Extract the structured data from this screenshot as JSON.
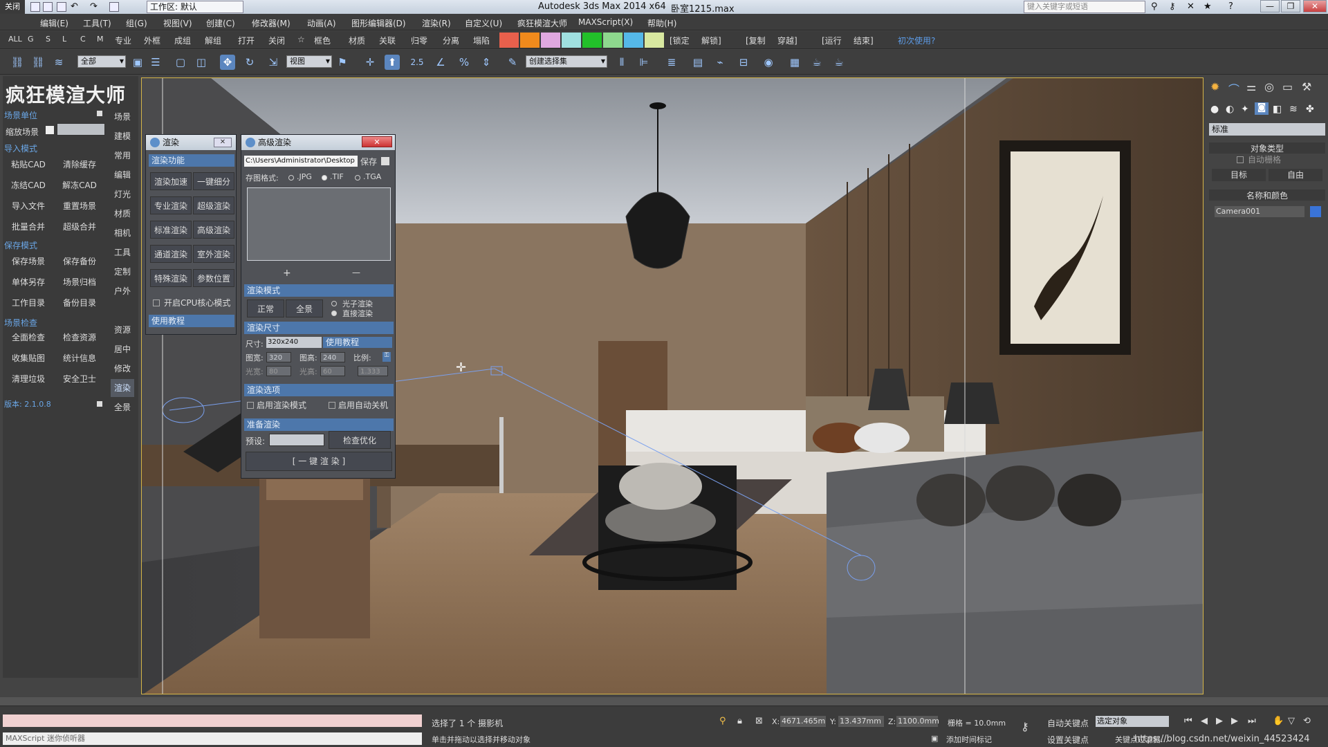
{
  "titlebar": {
    "close_label": "关闭",
    "workspace": "工作区: 默认",
    "app_title": "Autodesk 3ds Max  2014 x64",
    "file_name": "卧室1215.max",
    "search_placeholder": "键入关键字或短语"
  },
  "menu": [
    "编辑(E)",
    "工具(T)",
    "组(G)",
    "视图(V)",
    "创建(C)",
    "修改器(M)",
    "动画(A)",
    "图形编辑器(D)",
    "渲染(R)",
    "自定义(U)",
    "疯狂模渲大师",
    "MAXScript(X)",
    "帮助(H)"
  ],
  "quickrow": {
    "filters": [
      "ALL",
      "G",
      "S",
      "L",
      "C",
      "M"
    ],
    "items": [
      "专业",
      "外框",
      "成组",
      "解组",
      "打开",
      "关闭",
      "☆",
      "框色",
      "材质",
      "关联",
      "归零",
      "分离",
      "塌陷"
    ],
    "swatch_colors": [
      "#e8604c",
      "#f08a1c",
      "#e0a8e0",
      "#9fe0e0",
      "#22c02a",
      "#8ed88e",
      "#55b8e8",
      "#d8e8a0"
    ],
    "right_items": [
      "[锁定",
      "解锁]",
      "[复制",
      "穿越]",
      "[运行",
      "结束]",
      "初次使用?"
    ]
  },
  "toolbar": {
    "filter_select": "全部",
    "view_select": "视图",
    "selection_set": "创建选择集",
    "snap_label": "2.5"
  },
  "plugin": {
    "title": "疯狂模渲大师",
    "scene_unit": "场景单位",
    "scale_scene": "缩放场景",
    "import_mode": "导入模式",
    "import_buttons": [
      "粘贴CAD",
      "清除缓存",
      "冻结CAD",
      "解冻CAD",
      "导入文件",
      "重置场景",
      "批量合并",
      "超级合并"
    ],
    "save_mode": "保存模式",
    "save_buttons": [
      "保存场景",
      "保存备份",
      "单体另存",
      "场景归档",
      "工作目录",
      "备份目录"
    ],
    "check_mode": "场景检查",
    "check_buttons": [
      "全面检查",
      "检查资源",
      "收集贴图",
      "统计信息",
      "清理垃圾",
      "安全卫士"
    ],
    "version": "版本: 2.1.0.8",
    "tabs": [
      "场景",
      "建模",
      "常用",
      "编辑",
      "灯光",
      "材质",
      "相机",
      "工具",
      "定制",
      "户外",
      "资源",
      "居中",
      "修改",
      "渲染",
      "全景"
    ],
    "active_tab": "渲染"
  },
  "render_dialog": {
    "title": "渲染",
    "section": "渲染功能",
    "buttons": [
      "渲染加速",
      "一键细分",
      "专业渲染",
      "超级渲染",
      "标准渲染",
      "高级渲染",
      "通道渲染",
      "室外渲染",
      "特殊渲染",
      "参数位置"
    ],
    "cpu_checkbox": "开启CPU核心模式",
    "tutorial": "使用教程"
  },
  "adv_dialog": {
    "title": "高级渲染",
    "path": "C:\\Users\\Administrator\\Desktop",
    "save_label": "保存",
    "format_label": "存图格式:",
    "formats": [
      ".JPG",
      ".TIF",
      ".TGA"
    ],
    "selected_format": ".TIF",
    "plus": "+",
    "minus": "—",
    "mode_header": "渲染模式",
    "mode_normal": "正常",
    "mode_pano": "全景",
    "radio_photon": "光子渲染",
    "radio_direct": "直接渲染",
    "size_header": "渲染尺寸",
    "size_label": "尺寸:",
    "size_value": "320x240",
    "size_tutorial": "使用教程",
    "img_w_label": "图宽:",
    "img_w": "320",
    "img_h_label": "图高:",
    "img_h": "240",
    "ratio_label": "比例:",
    "light_w_label": "光宽:",
    "light_w": "80",
    "light_h_label": "光高:",
    "light_h": "60",
    "ratio_value": "1.333",
    "options_header": "渲染选项",
    "opt_render_mode": "启用渲染模式",
    "opt_auto_shutdown": "启用自动关机",
    "prep_header": "准备渲染",
    "preset_label": "预设:",
    "check_opt": "检查优化",
    "one_click": "[ 一 键 渲 染 ]"
  },
  "rpanel": {
    "dropdown": "标准",
    "object_type": "对象类型",
    "auto_grid": "自动栅格",
    "target": "目标",
    "free": "自由",
    "name_color": "名称和颜色",
    "camera_name": "Camera001"
  },
  "status": {
    "maxscript": "MAXScript 迷你侦听器",
    "selected": "选择了 1 个 摄影机",
    "hint": "单击并拖动以选择并移动对象",
    "x_label": "X:",
    "x": "4671.465m",
    "y_label": "Y:",
    "y": "13.437mm",
    "z_label": "Z:",
    "z": "1100.0mm",
    "grid": "栅格 = 10.0mm",
    "auto_key": "自动关键点",
    "set_key": "设置关键点",
    "key_filter": "选定对象",
    "add_time_tag": "添加时间标记",
    "key_filter2": "关键点过滤器...",
    "watermark": "https://blog.csdn.net/weixin_44523424"
  }
}
